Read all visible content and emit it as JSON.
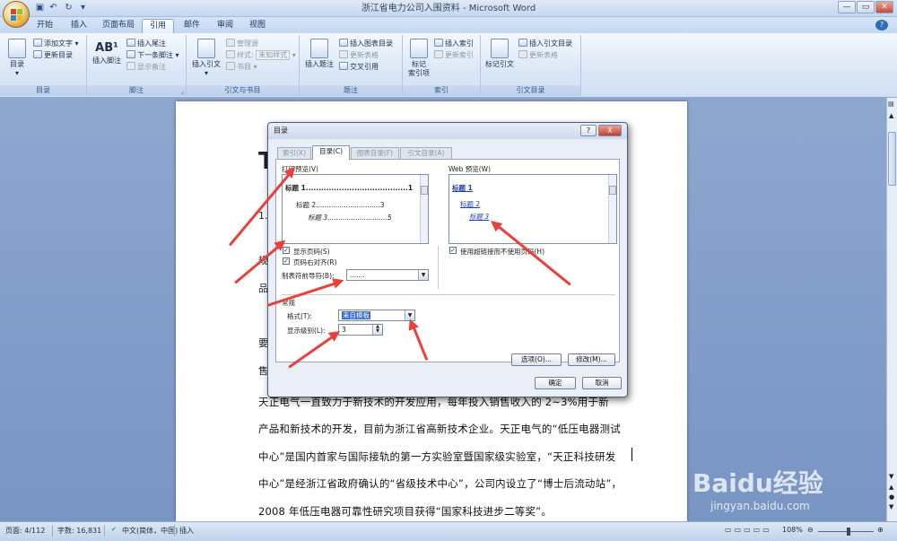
{
  "window": {
    "title": "浙江省电力公司入围资料 - Microsoft Word"
  },
  "tabs": [
    "开始",
    "插入",
    "页面布局",
    "引用",
    "邮件",
    "审阅",
    "视图"
  ],
  "ribbon": {
    "toc": {
      "big": "目录",
      "add_text": "添加文字",
      "update_toc": "更新目录",
      "label": "目录"
    },
    "footnotes": {
      "insert_footnote": "插入脚注",
      "insert_endnote": "插入尾注",
      "next_footnote": "下一条脚注",
      "show_notes": "显示备注",
      "label": "脚注"
    },
    "citations": {
      "insert_citation": "插入引文",
      "manage_sources": "管理源",
      "style_label": "样式:",
      "style_value": "未知样式",
      "bibliography": "书目",
      "label": "引文与书目"
    },
    "captions": {
      "insert_caption": "插入题注",
      "insert_table_of_figures": "插入图表目录",
      "update_table": "更新表格",
      "cross_reference": "交叉引用",
      "label": "题注"
    },
    "index": {
      "mark_entry_line1": "标记",
      "mark_entry_line2": "索引项",
      "insert_index": "插入索引",
      "update_index": "更新索引",
      "label": "索引"
    },
    "toa": {
      "mark_citation": "标记引文",
      "insert_toa": "插入引文目录",
      "update_table": "更新表格",
      "label": "引文目录"
    }
  },
  "document": {
    "fragments": [
      "T",
      "1.",
      "规",
      "品",
      "要",
      "售"
    ],
    "lines": [
      "天正电气一直致力于新技术的开发应用，每年投入销售收入的 2~3%用于新",
      "产品和新技术的开发，目前为浙江省高新技术企业。天正电气的“低压电器测试",
      "中心”是国内首家与国际接轨的第一方实验室暨国家级实验室，“天正科技研发",
      "中心”是经浙江省政府确认的“省级技术中心”，公司内设立了“博士后流动站”，",
      "2008 年低压电器可靠性研究项目获得“国家科技进步二等奖”。"
    ]
  },
  "dialog": {
    "title": "目录",
    "help": "?",
    "close": "X",
    "tabs": [
      "索引(X)",
      "目录(C)",
      "图表目录(F)",
      "引文目录(A)"
    ],
    "print_preview_label": "打印预览(V)",
    "print_preview": [
      {
        "text": "标题  1",
        "leader": "........................................",
        "page": "1"
      },
      {
        "text": "标题  2",
        "leader": "..............................",
        "page": "3"
      },
      {
        "text": "标题  3",
        "leader": "............................",
        "page": "5"
      }
    ],
    "web_preview_label": "Web 预览(W)",
    "web_preview": [
      "标题 1",
      "标题 2",
      "标题 3"
    ],
    "show_page_numbers": "显示页码(S)",
    "right_align": "页码右对齐(R)",
    "tab_leader_label": "制表符前导符(B):",
    "tab_leader_value": ".......",
    "use_hyperlinks": "使用超链接而不使用页码(H)",
    "general_label": "常规",
    "format_label": "格式(T):",
    "format_value": "来自模板",
    "levels_label": "显示级别(L):",
    "levels_value": "3",
    "options_btn": "选项(O)...",
    "modify_btn": "修改(M)...",
    "ok_btn": "确定",
    "cancel_btn": "取消"
  },
  "status": {
    "page": "页面: 4/112",
    "words": "字数: 16,831",
    "lang": "中文(简体，中国)",
    "mode": "插入",
    "zoom": "108%"
  },
  "watermark": {
    "brand": "Baidu经验",
    "url": "jingyan.baidu.com"
  }
}
